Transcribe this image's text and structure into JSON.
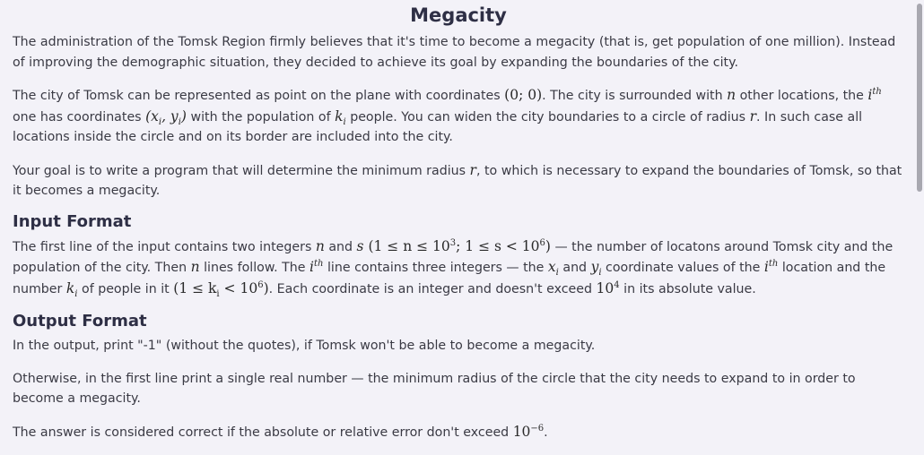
{
  "title": "Megacity",
  "p1": "The administration of the Tomsk Region firmly believes that it's time to become a megacity (that is, get population of one million). Instead of improving the demographic situation, they decided to achieve its goal by expanding the boundaries of the city.",
  "p2": {
    "t1": "The city of Tomsk can be represented as point on the plane with coordinates ",
    "origin": "(0; 0)",
    "t2": ". The city is surrounded with ",
    "n": "n",
    "t3": " other locations, the ",
    "i": "i",
    "th": "th",
    "t4": " one has coordinates ",
    "xy": "(x",
    "xy_i": "i",
    "xy_mid": ", y",
    "xy_i2": "i",
    "xy_end": ")",
    "t5": " with the population of ",
    "k": "k",
    "k_i": "i",
    "t6": " people. You can widen the city boundaries to a circle of radius ",
    "r": "r",
    "t7": ". In such case all locations inside the circle and on its border are included into the city."
  },
  "p3": {
    "t1": "Your goal is to write a program that will determine the minimum radius ",
    "r": "r",
    "t2": ", to which is necessary to expand the boundaries of Tomsk, so that it becomes a megacity."
  },
  "input_heading": "Input Format",
  "input": {
    "t1": "The first line of the input contains two integers ",
    "n": "n",
    "t2": " and ",
    "s": "s",
    "c1": " (1 ≤ n ≤ 10",
    "c1e": "3",
    "c2": "; 1 ≤ s < 10",
    "c2e": "6",
    "c3": ")",
    "t3": " — the number of locatons around Tomsk city and the population of the city. Then ",
    "n2": "n",
    "t4": " lines follow. The ",
    "i": "i",
    "th": "th",
    "t5": " line contains three integers — the ",
    "x": "x",
    "x_i": "i",
    "t6": " and ",
    "y": "y",
    "y_i": "i",
    "t7": " coordinate values of the ",
    "i2": "i",
    "th2": "th",
    "t8": " location and the number ",
    "k": "k",
    "k_i": "i",
    "t9": " of people in it ",
    "c4": "(1 ≤ k",
    "c4i": "i",
    "c5": " < 10",
    "c5e": "6",
    "c6": ")",
    "t10": ". Each coordinate is an integer and doesn't exceed ",
    "lim": "10",
    "lime": "4",
    "t11": " in its absolute value."
  },
  "output_heading": "Output Format",
  "out1": "In the output, print \"-1\" (without the quotes), if Tomsk won't be able to become a megacity.",
  "out2": "Otherwise, in the first line print a single real number — the minimum radius of the circle that the city needs to expand to in order to become a megacity.",
  "out3": {
    "t1": "The answer is considered correct if the absolute or relative error don't exceed ",
    "e": "10",
    "ee": "−6",
    "t2": "."
  }
}
